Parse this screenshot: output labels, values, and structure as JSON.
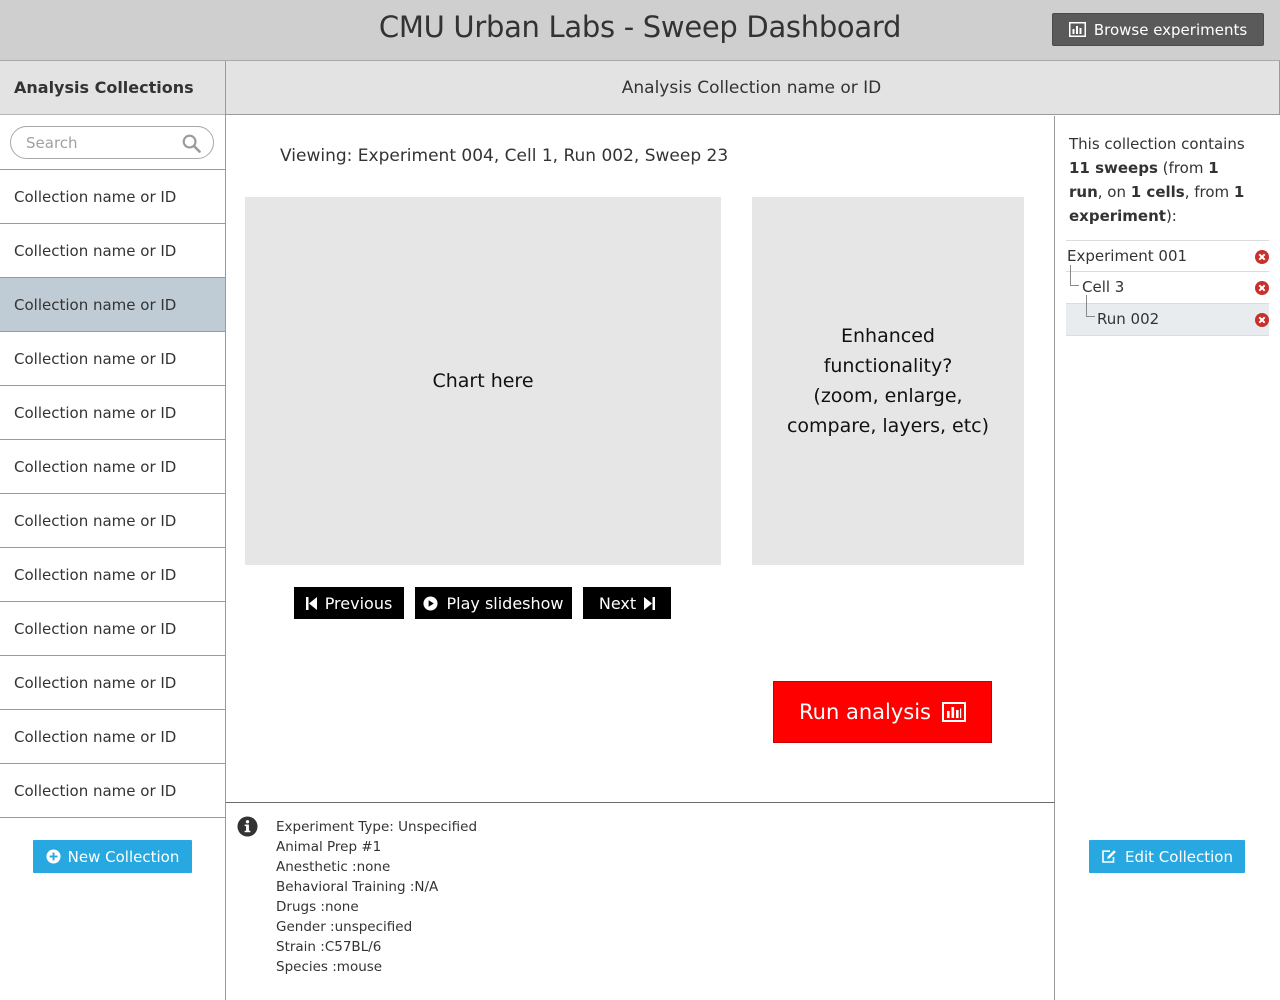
{
  "header": {
    "title": "CMU Urban Labs - Sweep Dashboard",
    "browse_label": "Browse experiments"
  },
  "sidebar": {
    "title": "Analysis Collections",
    "search_placeholder": "Search",
    "items": [
      {
        "label": "Collection name or ID",
        "active": false
      },
      {
        "label": "Collection name or ID",
        "active": false
      },
      {
        "label": "Collection name or ID",
        "active": true
      },
      {
        "label": "Collection name or ID",
        "active": false
      },
      {
        "label": "Collection name or ID",
        "active": false
      },
      {
        "label": "Collection name or ID",
        "active": false
      },
      {
        "label": "Collection name or ID",
        "active": false
      },
      {
        "label": "Collection name or ID",
        "active": false
      },
      {
        "label": "Collection name or ID",
        "active": false
      },
      {
        "label": "Collection name or ID",
        "active": false
      },
      {
        "label": "Collection name or ID",
        "active": false
      },
      {
        "label": "Collection name or ID",
        "active": false
      }
    ],
    "new_collection_label": "New Collection"
  },
  "center": {
    "collection_title": "Analysis Collection name or ID",
    "viewing": "Viewing: Experiment 004, Cell 1, Run 002, Sweep 23",
    "chart_placeholder": "Chart here",
    "enhanced_lines": [
      "Enhanced",
      "functionality?",
      "(zoom, enlarge,",
      "compare, layers, etc)"
    ],
    "prev_label": "Previous",
    "play_label": "Play slideshow",
    "next_label": "Next",
    "run_label": "Run analysis"
  },
  "info": {
    "lines": [
      "Experiment Type: Unspecified",
      "Animal Prep #1",
      "Anesthetic :none",
      "Behavioral Training :N/A",
      "Drugs :none",
      "Gender :unspecified",
      "Strain :C57BL/6",
      "Species :mouse"
    ]
  },
  "right": {
    "summary": {
      "prefix": "This collection contains",
      "sweeps": "11 sweeps",
      "from": " (from ",
      "runs": "1 run",
      "on": ", on ",
      "cells": "1 cells",
      "from2": ", from ",
      "experiments": "1 experiment",
      "suffix": "):"
    },
    "tree": [
      {
        "label": "Experiment 001",
        "level": 0
      },
      {
        "label": "Cell 3",
        "level": 1
      },
      {
        "label": "Run 002",
        "level": 2
      }
    ],
    "edit_label": "Edit Collection"
  },
  "colors": {
    "accent_blue": "#27a8e0",
    "run_red": "#ff0000",
    "delete_red": "#c9302c",
    "active_item": "#c0ccd5"
  }
}
